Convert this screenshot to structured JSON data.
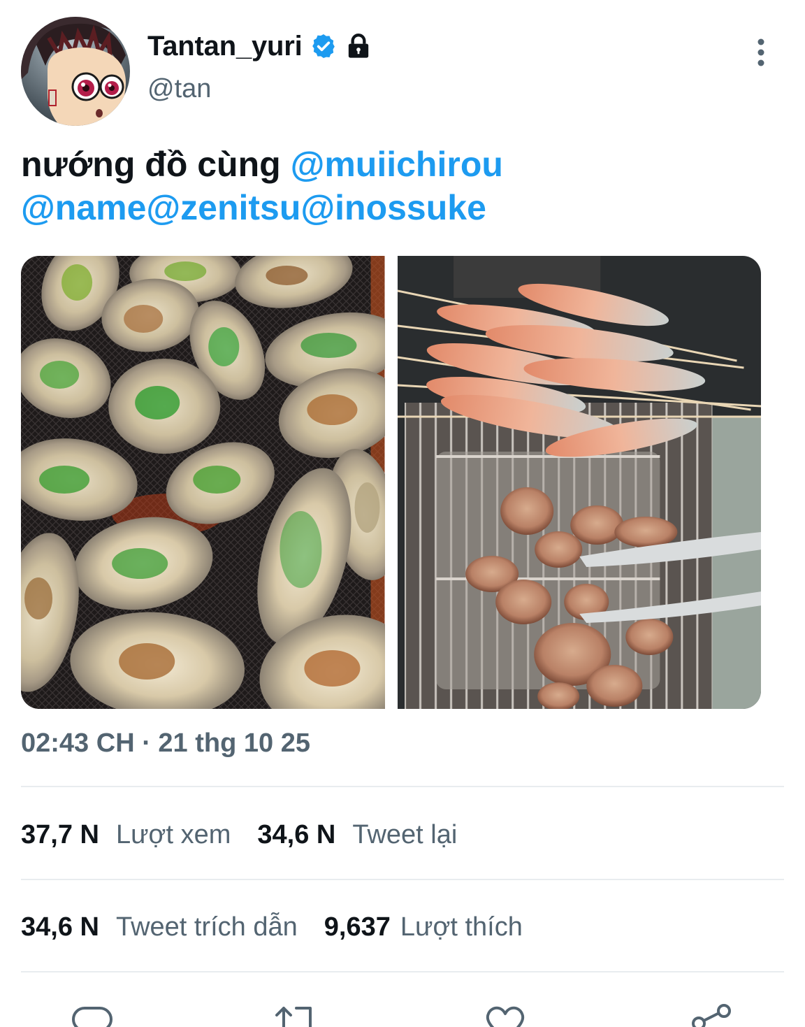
{
  "tweet": {
    "author": {
      "display_name": "Tantan_yuri",
      "handle": "@tan",
      "verified_icon": "verified-badge-icon",
      "lock_icon": "lock-icon"
    },
    "text": {
      "prefix": "nướng đồ cùng ",
      "mentions": [
        "@muiichirou",
        "@name",
        "@zenitsu",
        "@inossuke"
      ]
    },
    "media": [
      {
        "name": "grilled-oysters-photo"
      },
      {
        "name": "grilled-shrimp-and-meat-photo"
      }
    ],
    "timestamp": "02:43 CH · 21 thg 10 25",
    "stats": {
      "views": {
        "count": "37,7 N",
        "label": "Lượt xem"
      },
      "retweets": {
        "count": "34,6 N",
        "label": "Tweet lại"
      },
      "quotes": {
        "count": "34,6 N",
        "label": "Tweet trích dẫn"
      },
      "likes": {
        "count": "9,637",
        "label": "Lượt thích"
      }
    },
    "actions": [
      "reply-icon",
      "retweet-icon",
      "like-icon",
      "share-icon"
    ]
  },
  "colors": {
    "accent": "#1d9bf0",
    "text": "#0f1419",
    "secondary": "#536471",
    "divider": "#e8ecef"
  }
}
